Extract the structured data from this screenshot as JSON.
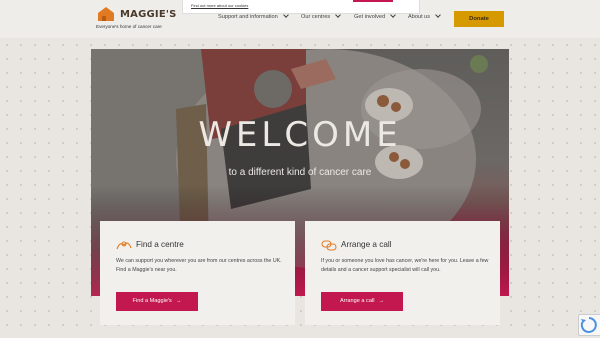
{
  "header": {
    "logo_text": "MAGGIE'S",
    "tagline": "Everyone's home of cancer care",
    "nav": [
      {
        "label": "Support and information"
      },
      {
        "label": "Our centres"
      },
      {
        "label": "Get involved"
      },
      {
        "label": "About us"
      }
    ],
    "donate_label": "Donate"
  },
  "cookie": {
    "link_text": "Find out more about our cookies"
  },
  "hero": {
    "title": "WELCOME",
    "subtitle": "to a different kind of cancer care"
  },
  "cards": [
    {
      "title": "Find a centre",
      "text": "We can support you wherever you are from our centres across the UK. Find a Maggie's near you.",
      "button_label": "Find a Maggie's",
      "icon": "pin-icon"
    },
    {
      "title": "Arrange a call",
      "text": "If you or someone you love has cancer, we're here for you. Leave a few details and a cancer support specialist will call you.",
      "button_label": "Arrange a call",
      "icon": "chat-icon"
    }
  ],
  "colors": {
    "accent": "#c2184f",
    "donate": "#d69a00",
    "background": "#e9e6e2"
  }
}
